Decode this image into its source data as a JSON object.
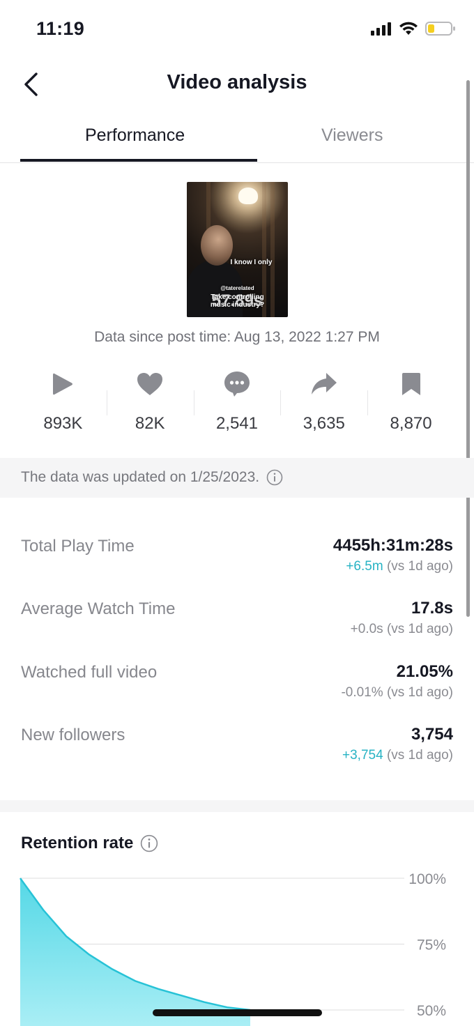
{
  "status_bar": {
    "time": "11:19"
  },
  "header": {
    "title": "Video analysis"
  },
  "tabs": [
    {
      "label": "Performance",
      "active": true
    },
    {
      "label": "Viewers",
      "active": false
    }
  ],
  "video": {
    "caption_line1": "I know I only",
    "handle": "@taterelated",
    "caption_line2": "Take controlling",
    "caption_line3": "music industry?",
    "duration": "57.89s"
  },
  "data_since": "Data since post time: Aug 13, 2022 1:27 PM",
  "stats": [
    {
      "icon": "play-icon",
      "value": "893K"
    },
    {
      "icon": "heart-icon",
      "value": "82K"
    },
    {
      "icon": "comment-icon",
      "value": "2,541"
    },
    {
      "icon": "share-icon",
      "value": "3,635"
    },
    {
      "icon": "bookmark-icon",
      "value": "8,870"
    }
  ],
  "update_notice": "The data was updated on 1/25/2023.",
  "metrics": [
    {
      "label": "Total Play Time",
      "value": "4455h:31m:28s",
      "delta_change": "+6.5m",
      "delta_suffix": " (vs 1d ago)",
      "positive": true
    },
    {
      "label": "Average Watch Time",
      "value": "17.8s",
      "delta_change": "+0.0s",
      "delta_suffix": " (vs 1d ago)",
      "positive": false
    },
    {
      "label": "Watched full video",
      "value": "21.05%",
      "delta_change": "-0.01%",
      "delta_suffix": " (vs 1d ago)",
      "positive": false
    },
    {
      "label": "New followers",
      "value": "3,754",
      "delta_change": "+3,754",
      "delta_suffix": " (vs 1d ago)",
      "positive": true
    }
  ],
  "retention": {
    "title": "Retention rate",
    "y_ticks": [
      "100%",
      "75%",
      "50%"
    ]
  },
  "chart_data": {
    "type": "area",
    "title": "Retention rate",
    "y_ticks": [
      100,
      75,
      50
    ],
    "ylim": [
      50,
      100
    ],
    "x": [
      0,
      1,
      2,
      3,
      4,
      5,
      6,
      7,
      8,
      9,
      10
    ],
    "values": [
      100,
      88,
      78,
      71,
      65.5,
      61,
      58,
      55.5,
      53,
      51,
      50
    ],
    "color": "#3fd0e0"
  },
  "colors": {
    "accent_teal": "#27b3c4",
    "chart_fill": "#7fe3ee",
    "chart_line": "#27c2d6"
  }
}
